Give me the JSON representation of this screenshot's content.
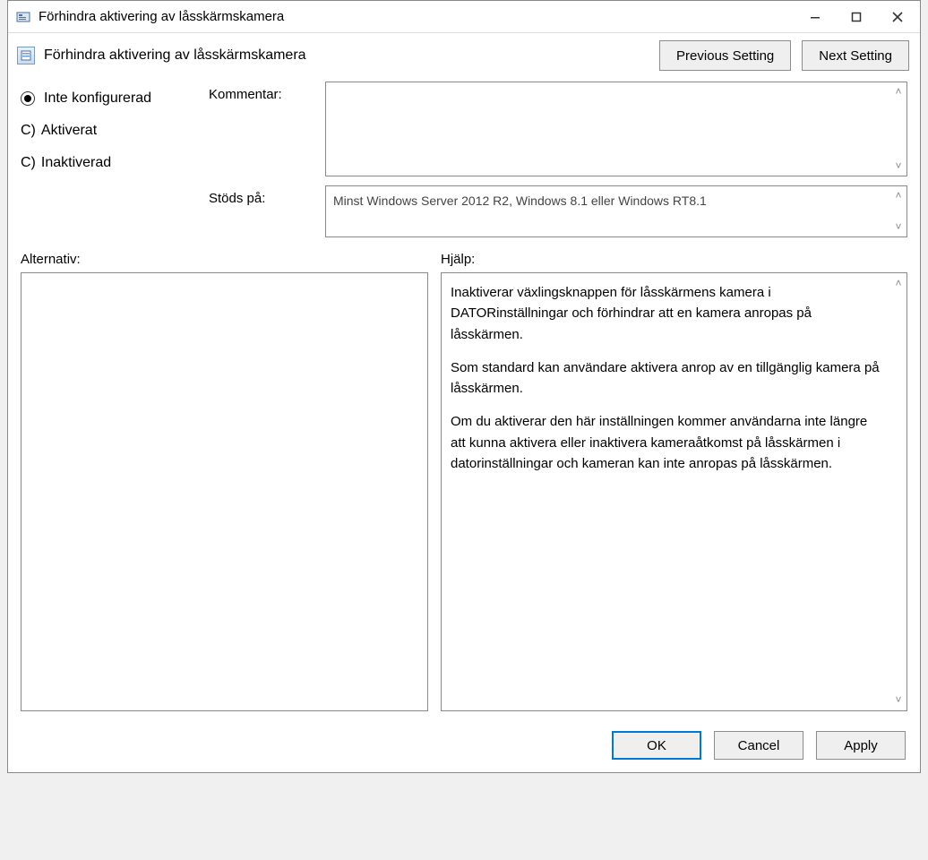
{
  "window": {
    "title": "Förhindra aktivering av låsskärmskamera"
  },
  "header": {
    "policy_title": "Förhindra aktivering av låsskärmskamera",
    "prev_btn": "Previous Setting",
    "next_btn": "Next Setting"
  },
  "state_options": {
    "not_configured": "Inte konfigurerad",
    "enabled_prefix": "C)",
    "enabled": "Aktiverat",
    "disabled_prefix": "C)",
    "disabled": "Inaktiverad",
    "selected": "not_configured"
  },
  "labels": {
    "comment": "Kommentar:",
    "supported": "Stöds på:",
    "options": "Alternativ:",
    "help": "Hjälp:"
  },
  "supported_text": "Minst Windows Server 2012 R2, Windows 8.1 eller Windows RT8.1",
  "help_paragraphs": [
    "Inaktiverar växlingsknappen för låsskärmens kamera i DATORinställningar och förhindrar att en kamera anropas på låsskärmen.",
    "Som standard kan användare aktivera anrop av en tillgänglig kamera på låsskärmen.",
    "Om du aktiverar den här inställningen kommer användarna inte längre att kunna aktivera eller inaktivera kameraåtkomst på låsskärmen i datorinställningar och kameran kan inte anropas på låsskärmen."
  ],
  "footer": {
    "ok": "OK",
    "cancel": "Cancel",
    "apply": "Apply"
  },
  "icons": {
    "app": "policy-editor-icon",
    "policy": "policy-setting-icon"
  }
}
